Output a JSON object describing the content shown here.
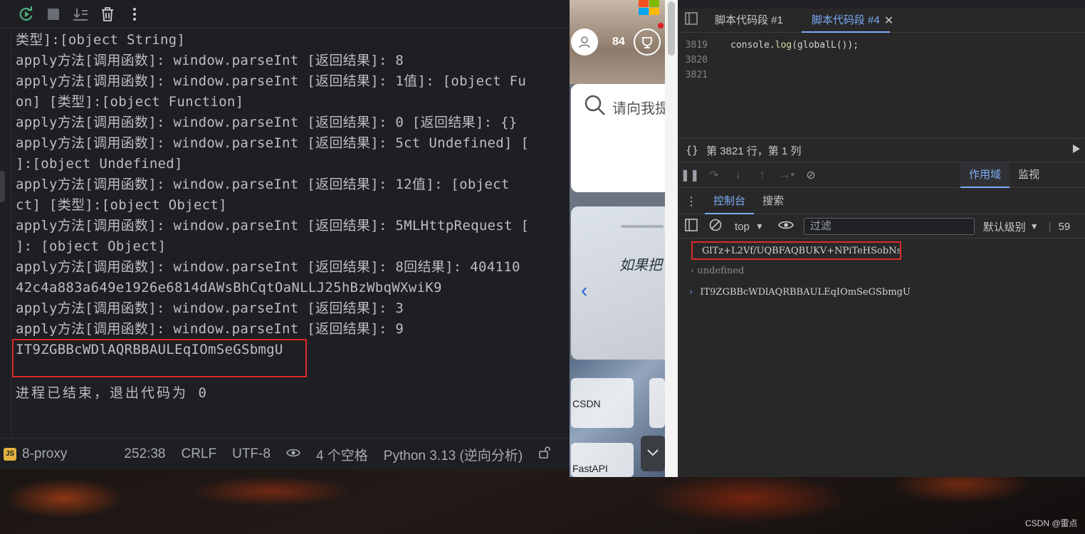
{
  "ide": {
    "toolbar_icons": [
      "rerun-icon",
      "stop-icon",
      "scroll-to-end-icon",
      "trash-icon",
      "more-icon"
    ],
    "console_lines": [
      "类型]:[object String]",
      "apply方法[调用函数]: window.parseInt [返回结果]: 8",
      "apply方法[调用函数]: window.parseInt [返回结果]: 1值]: [object Fu",
      "on] [类型]:[object Function]",
      "apply方法[调用函数]: window.parseInt [返回结果]: 0 [返回结果]: {}",
      "apply方法[调用函数]: window.parseInt [返回结果]: 5ct Undefined] [",
      "]:[object Undefined]",
      "apply方法[调用函数]: window.parseInt [返回结果]: 12值]: [object",
      "ct] [类型]:[object Object]",
      "apply方法[调用函数]: window.parseInt [返回结果]: 5MLHttpRequest [",
      "]: [object Object]",
      "apply方法[调用函数]: window.parseInt [返回结果]: 8回结果]: 404110",
      "42c4a883a649e1926e6814dAWsBhCqtOaNLLJ25hBzWbqWXwiK9",
      "apply方法[调用函数]: window.parseInt [返回结果]: 3",
      "apply方法[调用函数]: window.parseInt [返回结果]: 9",
      "IT9ZGBBcWDlAQRBBAULEqIOmSeGSbmgU"
    ],
    "exit_message": "进程已结束，退出代码为 0",
    "status": {
      "file_badge": "JS",
      "file_name": "8-proxy",
      "position": "252:38",
      "line_ending": "CRLF",
      "encoding": "UTF-8",
      "indent": "4 个空格",
      "interpreter": "Python 3.13 (逆向分析)"
    }
  },
  "browser": {
    "count": "84",
    "search_placeholder": "请向我提",
    "banner_text": "如果把",
    "tiles": [
      "CSDN",
      "FastAPI"
    ]
  },
  "devtools": {
    "tabs": [
      "脚本代码段 #1",
      "脚本代码段 #4"
    ],
    "active_tab": "脚本代码段 #4",
    "code_lines": [
      {
        "num": "3819",
        "code": "console.log(globalL());"
      },
      {
        "num": "3820",
        "code": ""
      },
      {
        "num": "3821",
        "code": ""
      }
    ],
    "cursor_position": "第 3821 行，第 1 列",
    "scope_tabs": [
      "作用域",
      "监视"
    ],
    "drawer_tabs": [
      "控制台",
      "搜索"
    ],
    "context": "top",
    "filter_placeholder": "过滤",
    "log_level": "默认级别",
    "issues_count": "59",
    "console_output": [
      {
        "prefix": "",
        "text": "GlTz+L2Vf/UQBFAQBUKV+NPiTeHSobNs"
      },
      {
        "prefix": "‹",
        "text": "undefined"
      },
      {
        "prefix": "›",
        "text": "IT9ZGBBcWDlAQRBBAULEqIOmSeGSbmgU"
      }
    ]
  },
  "watermark": "CSDN @雷点"
}
